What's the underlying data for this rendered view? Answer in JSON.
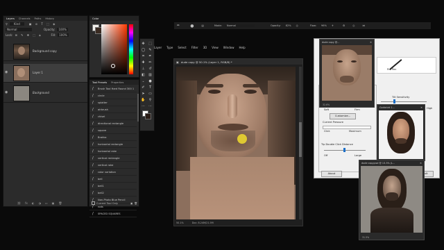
{
  "layers_panel": {
    "tabs": [
      "Layers",
      "Channels",
      "Paths",
      "History"
    ],
    "kind_label": "Kind",
    "blend_mode": "Normal",
    "opacity_label": "Opacity:",
    "opacity_value": "100%",
    "lock_label": "Lock:",
    "fill_label": "Fill:",
    "fill_value": "100%",
    "layers": [
      {
        "name": "Background copy",
        "visible": false
      },
      {
        "name": "Layer 1",
        "visible": true
      },
      {
        "name": "Background",
        "visible": true
      }
    ]
  },
  "color_panel": {
    "tab": "Color"
  },
  "tool_presets": {
    "tabs": [
      "Tool Presets",
      "Properties"
    ],
    "items": [
      "Brush Tool Hard Round 300 1",
      "circle",
      "splatter",
      "airbrush",
      "chisel",
      "directional rectangle",
      "square",
      "Brakka",
      "horizontal rectangle",
      "horizontal rake",
      "vertical rectangle",
      "vertical rake",
      "color variation",
      "bell",
      "bell1",
      "bell2",
      "Non-Photo Blue Pencil",
      "rods",
      "SPACED SQUARES",
      "square_small"
    ],
    "current_only_label": "Current Tool Only"
  },
  "main_menu": {
    "items": [
      "Layer",
      "Type",
      "Select",
      "Filter",
      "3D",
      "View",
      "Window",
      "Help"
    ]
  },
  "options_bar": {
    "mode_label": "Mode:",
    "mode_value": "Normal",
    "opacity_label": "Opacity:",
    "opacity_value": "82%",
    "flow_label": "Flow:",
    "flow_value": "96%"
  },
  "document": {
    "title": "dude copy @ 50.1% (Layer 1, RGB/8) *",
    "zoom": "50.1%",
    "doc_size": "Doc: 8.24M/21.5M"
  },
  "ref_window_1": {
    "title": "dude copy @...",
    "zoom": "32.6%"
  },
  "ref_window_2": {
    "title": "Goldshirt 1...",
    "zoom": ""
  },
  "ref_window_3": {
    "title": "dude copy.psd @ 13.3% (L...",
    "zoom": "31.5%"
  },
  "pen_settings": {
    "pen_label": "Pro Pen",
    "soft_label": "Soft",
    "firm_label": "Firm",
    "customize_label": "Customize...",
    "current_pressure_label": "Current Pressure",
    "click_label": "Click",
    "maximum_label": "Maximum",
    "tip_double_click_label": "Tip Double Click Distance",
    "off_label": "Off",
    "large_label": "Large",
    "tilt_label": "Tilt Sensitivity",
    "high_label": "High",
    "about_label": "About",
    "default_label": "Default"
  },
  "colors": {
    "panel_bg": "#2b2b2b",
    "app_bg": "#0a0a0a",
    "settings_bg": "#f0f0f0",
    "cursor_yellow": "#e8d330",
    "hue_red": "#ff0000"
  }
}
